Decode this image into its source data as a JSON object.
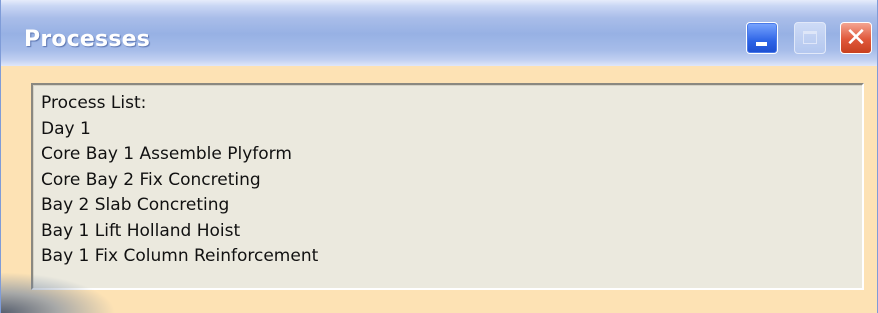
{
  "window": {
    "title": "Processes",
    "controls": {
      "minimize_icon": "minimize-icon",
      "maximize_icon": "maximize-icon",
      "close_icon": "close-icon",
      "close_glyph": "✕"
    },
    "colors": {
      "frame": "#fde2b4",
      "titlebar": "#97b1e4",
      "close": "#e0583a",
      "listbox_bg": "#ebe9de"
    }
  },
  "list": {
    "header": "Process List:",
    "items": [
      "Day 1",
      "Core Bay 1 Assemble Plyform",
      "Core Bay 2 Fix Concreting",
      "Bay 2 Slab Concreting",
      "Bay 1 Lift Holland Hoist",
      "Bay 1 Fix Column Reinforcement"
    ]
  }
}
